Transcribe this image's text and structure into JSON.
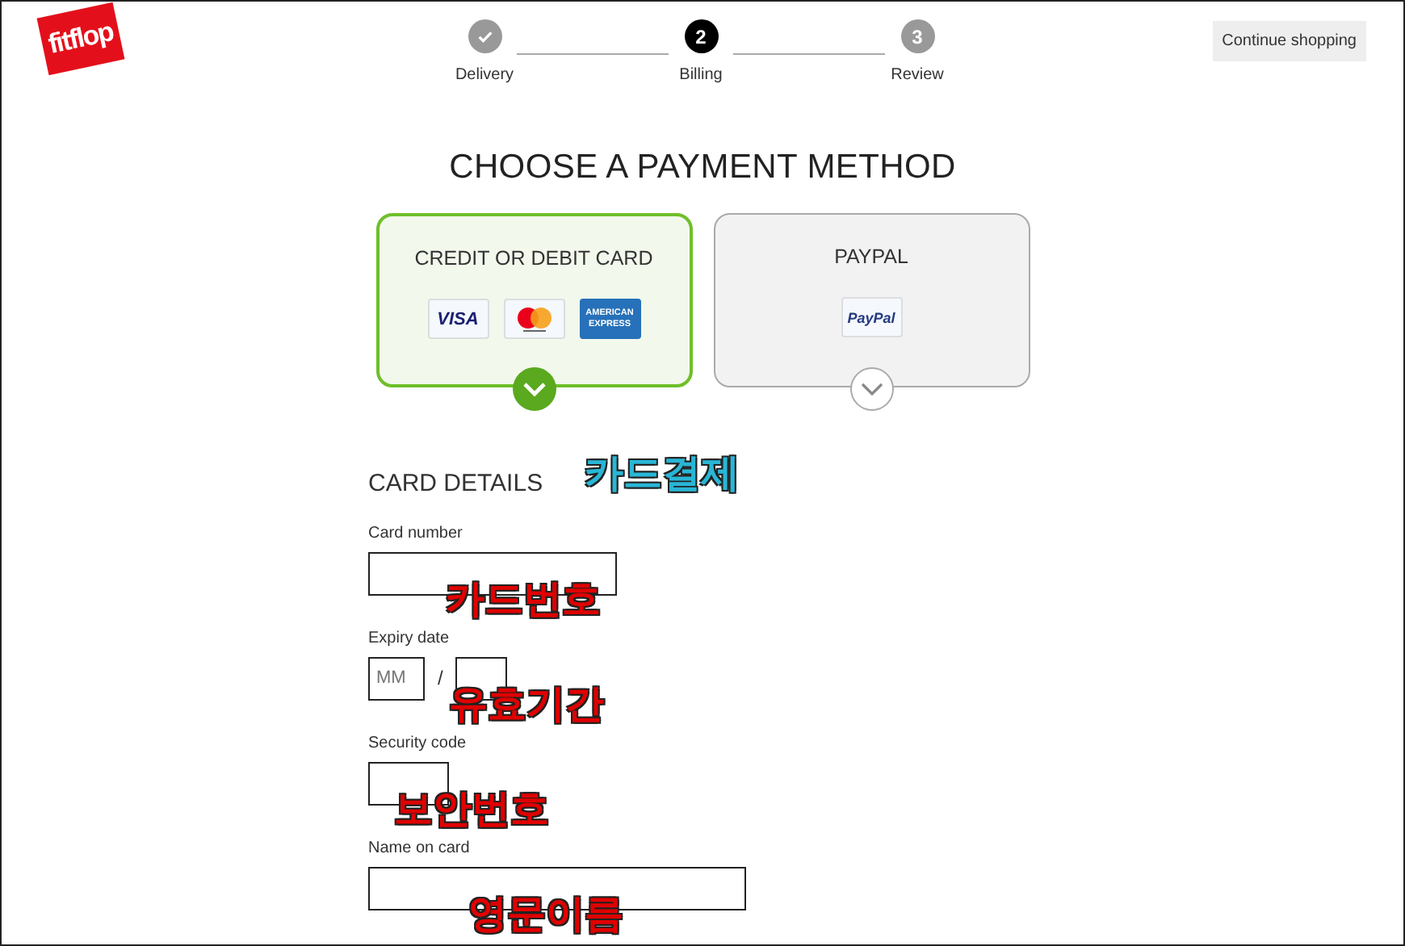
{
  "logo": {
    "text": "fitflop"
  },
  "steps": [
    {
      "label": "Delivery",
      "done": true,
      "selected": false
    },
    {
      "label": "Billing",
      "number": "2",
      "done": false,
      "selected": true
    },
    {
      "label": "Review",
      "number": "3",
      "done": false,
      "selected": false
    }
  ],
  "continue_button": "Continue shopping",
  "title": "CHOOSE A PAYMENT METHOD",
  "payment_methods": [
    {
      "label": "CREDIT OR DEBIT CARD",
      "selected": true,
      "logos": [
        {
          "kind": "visa",
          "text": "VISA"
        },
        {
          "kind": "mastercard"
        },
        {
          "kind": "amex",
          "text": "AMERICAN EXPRESS"
        }
      ]
    },
    {
      "label": "PAYPAL",
      "selected": false,
      "logos": [
        {
          "kind": "paypal",
          "text": "PayPal"
        }
      ]
    }
  ],
  "card_details": {
    "heading": "CARD DETAILS",
    "annotation": {
      "text": "카드결제",
      "color": "#29b6d6"
    },
    "fields": [
      {
        "kind": "card",
        "label": "Card number",
        "annotation": {
          "text": "카드번호",
          "color": "#e00000"
        }
      },
      {
        "kind": "expiry",
        "label": "Expiry date",
        "placeholder": "MM",
        "separator": "/",
        "annotation": {
          "text": "유효기간",
          "color": "#e00000"
        }
      },
      {
        "kind": "security",
        "label": "Security code",
        "annotation": {
          "text": "보안번호",
          "color": "#e00000"
        }
      },
      {
        "kind": "name",
        "label": "Name on card",
        "annotation": {
          "text": "영문이름",
          "color": "#e00000"
        }
      }
    ]
  }
}
